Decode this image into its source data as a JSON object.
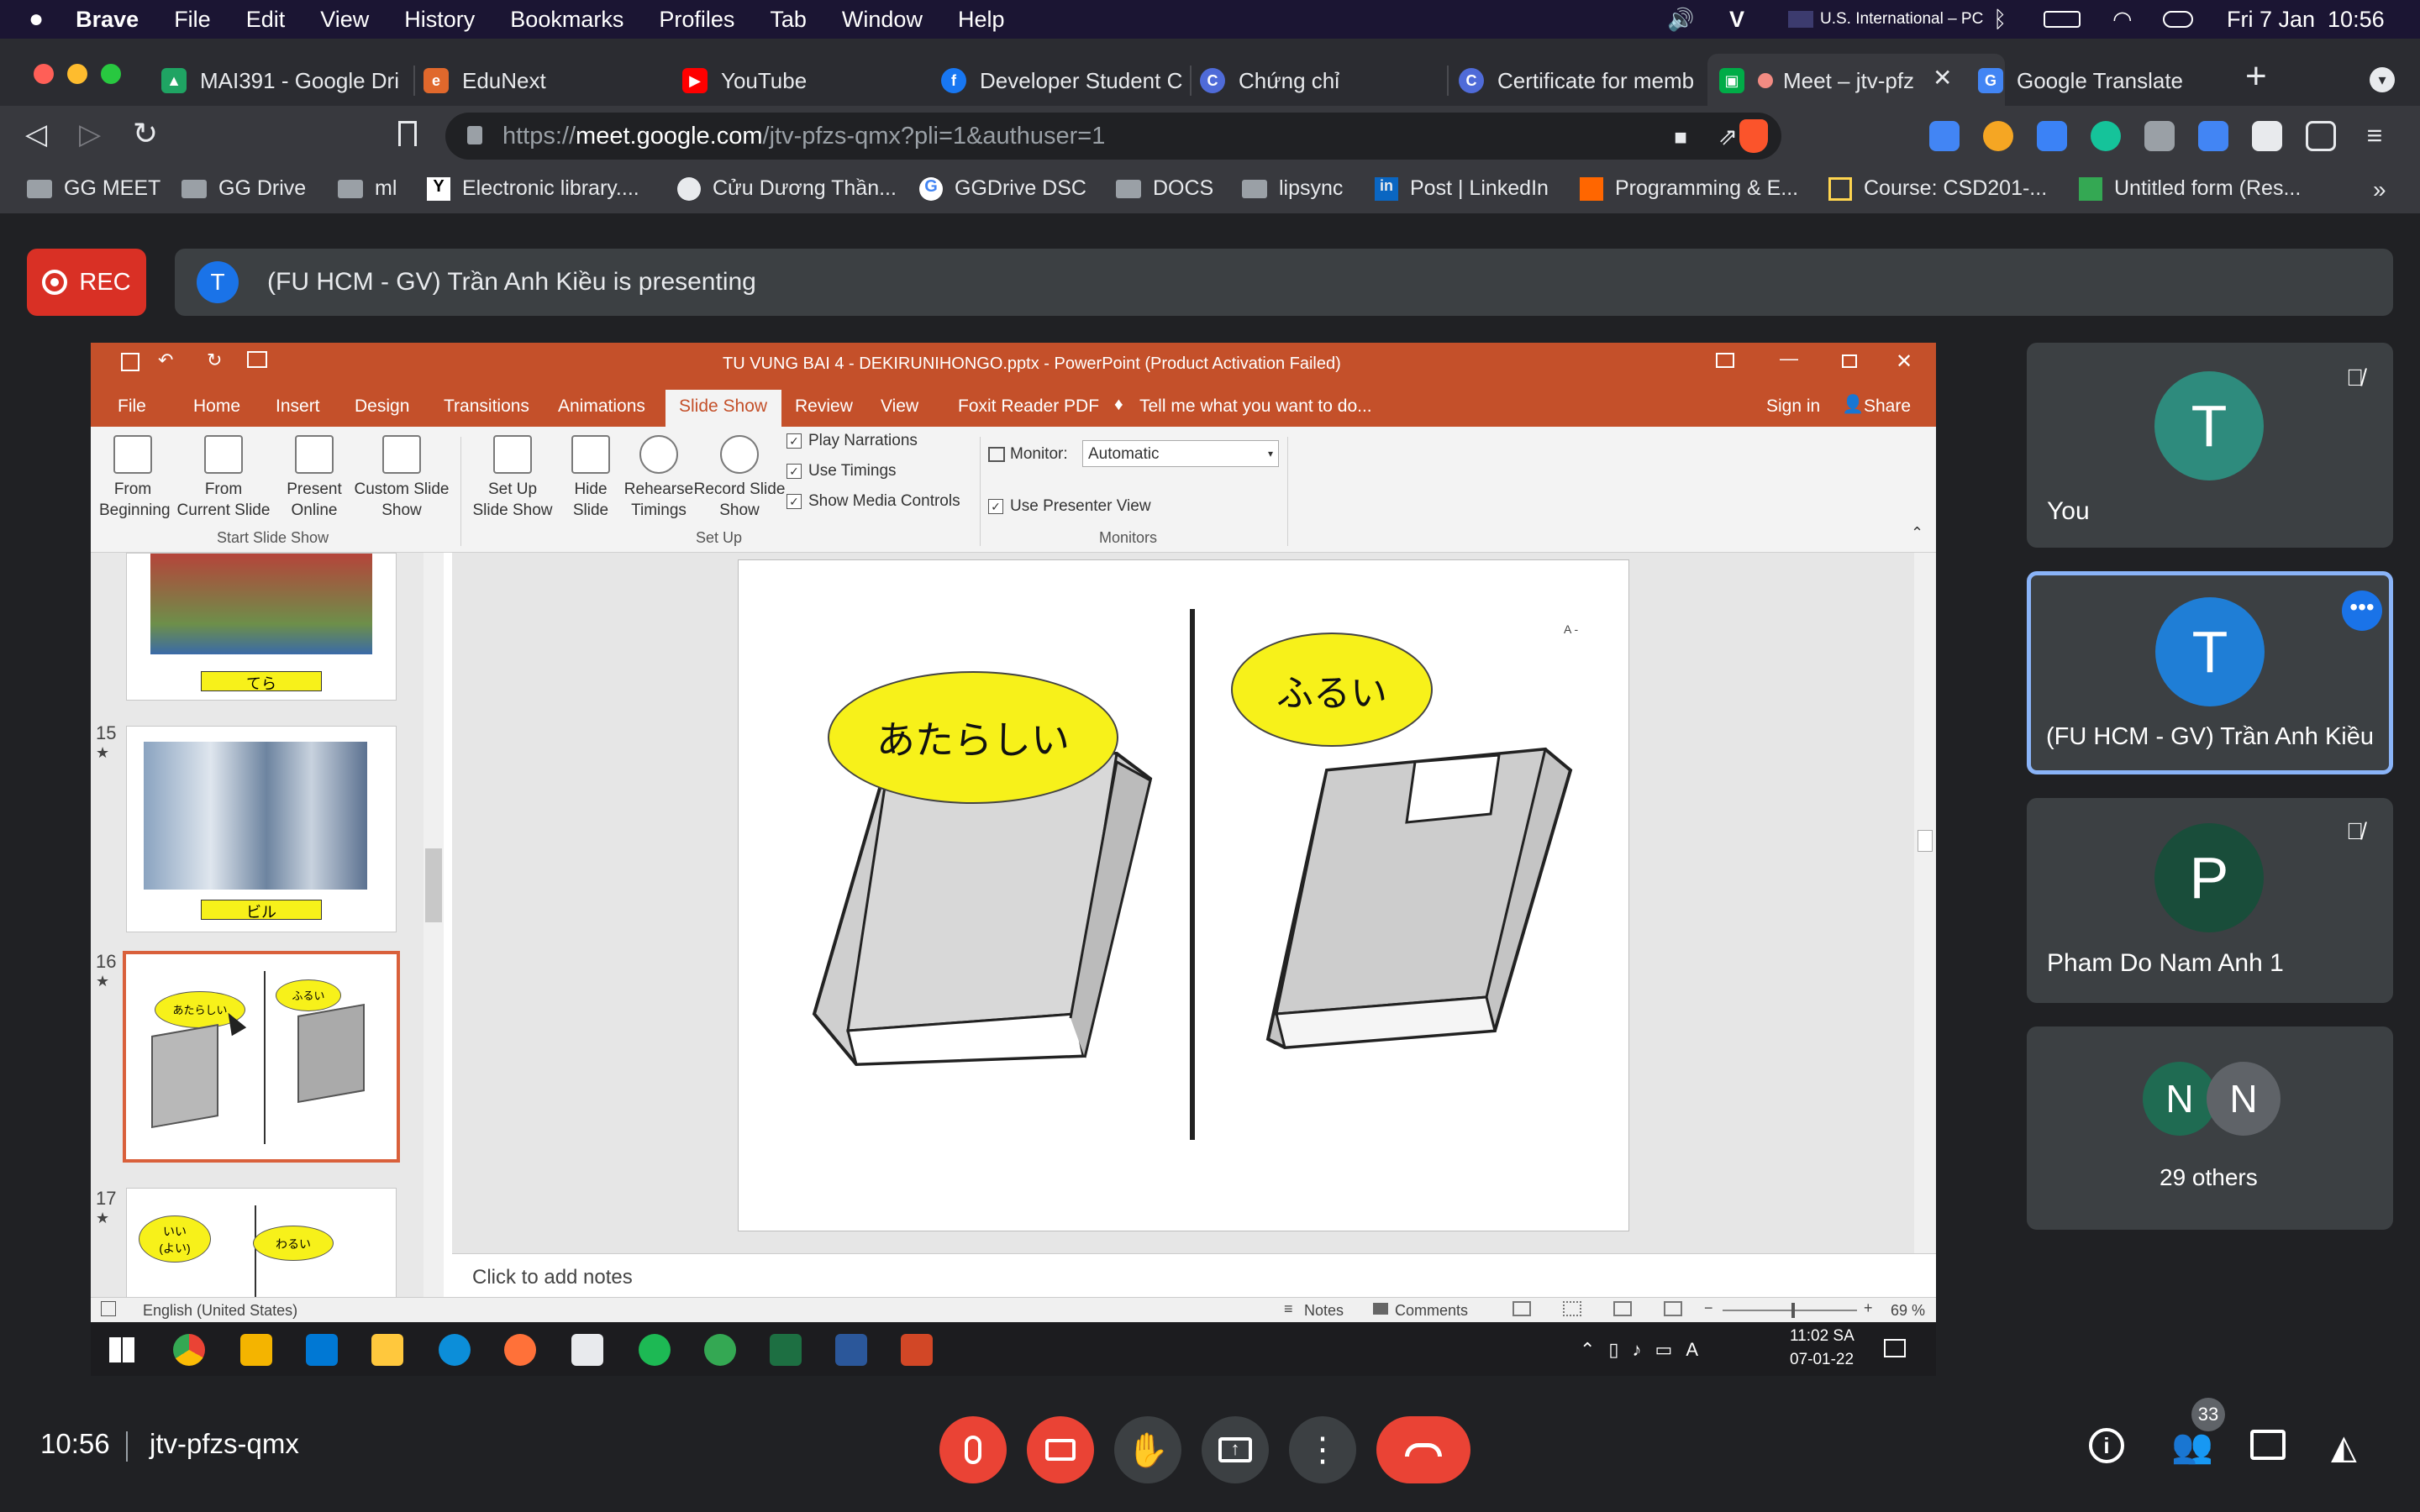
{
  "macmenu": {
    "app": "Brave",
    "items": [
      "File",
      "Edit",
      "View",
      "History",
      "Bookmarks",
      "Profiles",
      "Tab",
      "Window",
      "Help"
    ],
    "input_source": "U.S. International – PC",
    "datetime": "Fri 7 Jan  10:56"
  },
  "tabs": [
    {
      "title": "MAI391 - Google Dri",
      "color": "#1fa463"
    },
    {
      "title": "EduNext",
      "color": "#e0682c"
    },
    {
      "title": "YouTube",
      "color": "#ff0000"
    },
    {
      "title": "Developer Student C",
      "color": "#1877f2"
    },
    {
      "title": "Chứng chỉ",
      "color": "#4f6bd8"
    },
    {
      "title": "Certificate for memb",
      "color": "#4f6bd8"
    },
    {
      "title": "Meet – jtv-pfz",
      "color": "#00ac47"
    },
    {
      "title": "Google Translate",
      "color": "#4285f4"
    }
  ],
  "address": {
    "prefix": "https://",
    "domain": "meet.google.com",
    "path": "/jtv-pfzs-qmx?pli=1&authuser=1"
  },
  "bookmarks": [
    "GG MEET",
    "GG Drive",
    "ml",
    "Electronic library....",
    "Cửu Dương Thần...",
    "GGDrive DSC",
    "DOCS",
    "lipsync",
    "Post | LinkedIn",
    "Programming & E...",
    "Course: CSD201-...",
    "Untitled form (Res..."
  ],
  "meet": {
    "rec": "REC",
    "presenter_initial": "T",
    "presenting_text": "(FU HCM - GV) Trần Anh Kiều is presenting",
    "time": "10:56",
    "code": "jtv-pfzs-qmx",
    "people_count": "33",
    "participants": [
      {
        "initial": "T",
        "name": "You",
        "color": "#2e8b7d"
      },
      {
        "initial": "T",
        "name": "(FU HCM - GV) Trần Anh Kiều",
        "color": "#1f7ed6"
      },
      {
        "initial": "P",
        "name": "Pham Do Nam Anh 1",
        "color": "#194d3a"
      },
      {
        "initial_a": "N",
        "initial_b": "N",
        "name": "29 others",
        "color": "#1f6b52"
      }
    ]
  },
  "ppt": {
    "title": "TU VUNG BAI 4 - DEKIRUNIHONGO.pptx - PowerPoint (Product Activation Failed)",
    "tabs": [
      "File",
      "Home",
      "Insert",
      "Design",
      "Transitions",
      "Animations",
      "Slide Show",
      "Review",
      "View",
      "Foxit Reader PDF",
      "Tell me what you want to do..."
    ],
    "sign_in": "Sign in",
    "share": "Share",
    "ribbon": {
      "from_beginning": [
        "From",
        "Beginning"
      ],
      "from_current": [
        "From",
        "Current Slide"
      ],
      "present_online": [
        "Present",
        "Online"
      ],
      "custom_show": [
        "Custom Slide",
        "Show"
      ],
      "setup_show": [
        "Set Up",
        "Slide Show"
      ],
      "hide_slide": [
        "Hide",
        "Slide"
      ],
      "rehearse": [
        "Rehearse",
        "Timings"
      ],
      "record": [
        "Record Slide",
        "Show"
      ],
      "play_narrations": "Play Narrations",
      "use_timings": "Use Timings",
      "show_media": "Show Media Controls",
      "monitor_label": "Monitor:",
      "monitor_value": "Automatic",
      "presenter_view": "Use Presenter View",
      "group_start": "Start Slide Show",
      "group_setup": "Set Up",
      "group_monitors": "Monitors"
    },
    "thumbs": {
      "label_14": "てら",
      "num_15": "15",
      "label_15": "ビル",
      "num_16": "16",
      "bubble_new": "あたらしい",
      "bubble_old": "ふるい",
      "num_17": "17",
      "bubble_good": "いい\n(よい)",
      "bubble_bad": "わるい"
    },
    "slide": {
      "left_bubble": "あたらしい",
      "right_bubble": "ふるい",
      "corner": "A -"
    },
    "notes_placeholder": "Click to add notes",
    "language": "English (United States)",
    "notes_btn": "Notes",
    "comments_btn": "Comments",
    "zoom": "69 %",
    "win_clock": "11:02 SA",
    "win_date": "07-01-22"
  }
}
